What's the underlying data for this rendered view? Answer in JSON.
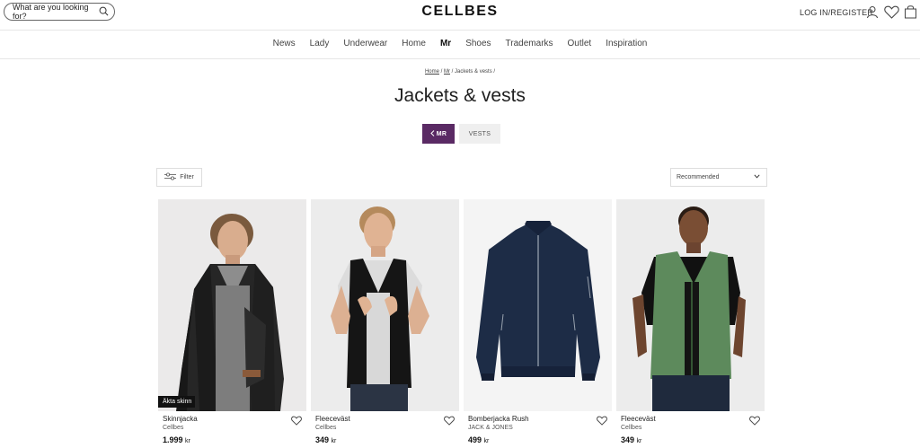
{
  "header": {
    "search_placeholder": "What are you looking for?",
    "logo": "CELLBES",
    "login_label": "LOG IN/REGISTER",
    "icons": [
      "search-icon",
      "user-icon",
      "heart-icon",
      "bag-icon"
    ]
  },
  "nav": {
    "items": [
      {
        "label": "News"
      },
      {
        "label": "Lady"
      },
      {
        "label": "Underwear"
      },
      {
        "label": "Home"
      },
      {
        "label": "Mr",
        "active": true
      },
      {
        "label": "Shoes"
      },
      {
        "label": "Trademarks"
      },
      {
        "label": "Outlet"
      },
      {
        "label": "Inspiration"
      }
    ]
  },
  "breadcrumb": {
    "home": "Home",
    "sep1": " / ",
    "mr": "Mr",
    "sep2": " / ",
    "current": "Jackets & vests /"
  },
  "page_title": "Jackets & vests",
  "chips": {
    "back": "MR",
    "vests": "VESTS"
  },
  "toolbar": {
    "filter_label": "Filter",
    "sort_selected": "Recommended"
  },
  "products": [
    {
      "name": "Skinnjacka",
      "brand": "Cellbes",
      "price": "1.999",
      "currency": "kr",
      "badge": "Äkta skinn"
    },
    {
      "name": "Fleeceväst",
      "brand": "Cellbes",
      "price": "349",
      "currency": "kr"
    },
    {
      "name": "Bomberjacka Rush",
      "brand": "JACK & JONES",
      "price": "499",
      "currency": "kr"
    },
    {
      "name": "Fleeceväst",
      "brand": "Cellbes",
      "price": "349",
      "currency": "kr"
    }
  ],
  "colors": {
    "accent": "#5a2a64",
    "chip_inactive": "#efefef",
    "photo_bg": "#ededed"
  }
}
